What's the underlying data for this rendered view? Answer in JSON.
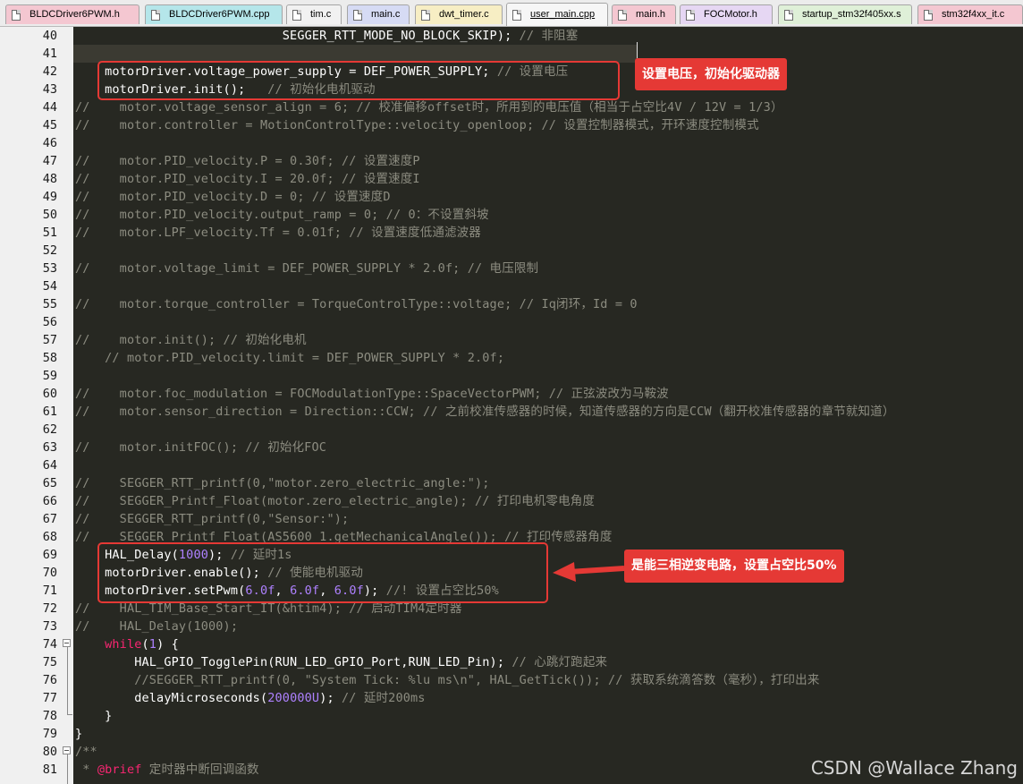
{
  "tabs": [
    {
      "label": "BLDCDriver6PWM.h",
      "color": "#f4c7d1",
      "active": false
    },
    {
      "label": "BLDCDriver6PWM.cpp",
      "color": "#b5e6ea",
      "active": false
    },
    {
      "label": "tim.c",
      "color": "#f1f1f1",
      "active": false
    },
    {
      "label": "main.c",
      "color": "#d6dbf4",
      "active": false
    },
    {
      "label": "dwt_timer.c",
      "color": "#f7eec4",
      "active": false
    },
    {
      "label": "user_main.cpp",
      "color": "#e8f1d2",
      "active": true
    },
    {
      "label": "main.h",
      "color": "#f4c7d1",
      "active": false
    },
    {
      "label": "FOCMotor.h",
      "color": "#e6d7f3",
      "active": false
    },
    {
      "label": "startup_stm32f405xx.s",
      "color": "#dff0d8",
      "active": false
    },
    {
      "label": "stm32f4xx_it.c",
      "color": "#f4c7d1",
      "active": false
    }
  ],
  "lines": [
    {
      "n": "40",
      "t": [
        [
          "code",
          "                            SEGGER_RTT_MODE_NO_BLOCK_SKIP); "
        ],
        [
          "cm",
          "// 非阻塞"
        ]
      ]
    },
    {
      "n": "41",
      "t": []
    },
    {
      "n": "42",
      "t": [
        [
          "code",
          "    motorDriver.voltage_power_supply = DEF_POWER_SUPPLY; "
        ],
        [
          "cm",
          "// 设置电压"
        ]
      ]
    },
    {
      "n": "43",
      "t": [
        [
          "code",
          "    motorDriver.init();   "
        ],
        [
          "cm",
          "// 初始化电机驱动"
        ]
      ]
    },
    {
      "n": "44",
      "t": [
        [
          "cm",
          "//    motor.voltage_sensor_align = 6; // 校准偏移offset时，所用到的电压值（相当于占空比4V / 12V = 1/3）"
        ]
      ]
    },
    {
      "n": "45",
      "t": [
        [
          "cm",
          "//    motor.controller = MotionControlType::velocity_openloop; // 设置控制器模式，开环速度控制模式"
        ]
      ]
    },
    {
      "n": "46",
      "t": []
    },
    {
      "n": "47",
      "t": [
        [
          "cm",
          "//    motor.PID_velocity.P = 0.30f; // 设置速度P"
        ]
      ]
    },
    {
      "n": "48",
      "t": [
        [
          "cm",
          "//    motor.PID_velocity.I = 20.0f; // 设置速度I"
        ]
      ]
    },
    {
      "n": "49",
      "t": [
        [
          "cm",
          "//    motor.PID_velocity.D = 0; // 设置速度D"
        ]
      ]
    },
    {
      "n": "50",
      "t": [
        [
          "cm",
          "//    motor.PID_velocity.output_ramp = 0; // 0：不设置斜坡"
        ]
      ]
    },
    {
      "n": "51",
      "t": [
        [
          "cm",
          "//    motor.LPF_velocity.Tf = 0.01f; // 设置速度低通滤波器"
        ]
      ]
    },
    {
      "n": "52",
      "t": []
    },
    {
      "n": "53",
      "t": [
        [
          "cm",
          "//    motor.voltage_limit = DEF_POWER_SUPPLY * 2.0f; // 电压限制"
        ]
      ]
    },
    {
      "n": "54",
      "t": []
    },
    {
      "n": "55",
      "t": [
        [
          "cm",
          "//    motor.torque_controller = TorqueControlType::voltage; // Iq闭环，Id = 0"
        ]
      ]
    },
    {
      "n": "56",
      "t": []
    },
    {
      "n": "57",
      "t": [
        [
          "cm",
          "//    motor.init(); // 初始化电机"
        ]
      ]
    },
    {
      "n": "58",
      "t": [
        [
          "cm",
          "    // motor.PID_velocity.limit = DEF_POWER_SUPPLY * 2.0f;"
        ]
      ]
    },
    {
      "n": "59",
      "t": []
    },
    {
      "n": "60",
      "t": [
        [
          "cm",
          "//    motor.foc_modulation = FOCModulationType::SpaceVectorPWM; // 正弦波改为马鞍波"
        ]
      ]
    },
    {
      "n": "61",
      "t": [
        [
          "cm",
          "//    motor.sensor_direction = Direction::CCW; // 之前校准传感器的时候，知道传感器的方向是CCW（翻开校准传感器的章节就知道）"
        ]
      ]
    },
    {
      "n": "62",
      "t": []
    },
    {
      "n": "63",
      "t": [
        [
          "cm",
          "//    motor.initFOC(); // 初始化FOC"
        ]
      ]
    },
    {
      "n": "64",
      "t": []
    },
    {
      "n": "65",
      "t": [
        [
          "cm",
          "//    SEGGER_RTT_printf(0,\"motor.zero_electric_angle:\");"
        ]
      ]
    },
    {
      "n": "66",
      "t": [
        [
          "cm",
          "//    SEGGER_Printf_Float(motor.zero_electric_angle); // 打印电机零电角度"
        ]
      ]
    },
    {
      "n": "67",
      "t": [
        [
          "cm",
          "//    SEGGER_RTT_printf(0,\"Sensor:\");"
        ]
      ]
    },
    {
      "n": "68",
      "t": [
        [
          "cm",
          "//    SEGGER_Printf_Float(AS5600_1.getMechanicalAngle()); // 打印传感器角度"
        ]
      ]
    },
    {
      "n": "69",
      "t": [
        [
          "code",
          "    HAL_Delay("
        ],
        [
          "num",
          "1000"
        ],
        [
          "code",
          "); "
        ],
        [
          "cm",
          "// 延时1s"
        ]
      ]
    },
    {
      "n": "70",
      "t": [
        [
          "code",
          "    motorDriver.enable(); "
        ],
        [
          "cm",
          "// 使能电机驱动"
        ]
      ]
    },
    {
      "n": "71",
      "t": [
        [
          "code",
          "    motorDriver.setPwm("
        ],
        [
          "num",
          "6.0f"
        ],
        [
          "code",
          ", "
        ],
        [
          "num",
          "6.0f"
        ],
        [
          "code",
          ", "
        ],
        [
          "num",
          "6.0f"
        ],
        [
          "code",
          "); "
        ],
        [
          "cm",
          "//! 设置占空比50%"
        ]
      ]
    },
    {
      "n": "72",
      "t": [
        [
          "cm",
          "//    HAL_TIM_Base_Start_IT(&htim4); // 启动TIM4定时器"
        ]
      ]
    },
    {
      "n": "73",
      "t": [
        [
          "cm",
          "//    HAL_Delay(1000);"
        ]
      ]
    },
    {
      "n": "74",
      "t": [
        [
          "code",
          "    "
        ],
        [
          "kw",
          "while"
        ],
        [
          "code",
          "("
        ],
        [
          "num",
          "1"
        ],
        [
          "code",
          ") {"
        ]
      ]
    },
    {
      "n": "75",
      "t": [
        [
          "code",
          "        HAL_GPIO_TogglePin(RUN_LED_GPIO_Port,RUN_LED_Pin); "
        ],
        [
          "cm",
          "// 心跳灯跑起来"
        ]
      ]
    },
    {
      "n": "76",
      "t": [
        [
          "cm",
          "        //SEGGER_RTT_printf(0, \"System Tick: %lu ms\\n\", HAL_GetTick()); // 获取系统滴答数（毫秒），打印出来"
        ]
      ]
    },
    {
      "n": "77",
      "t": [
        [
          "code",
          "        delayMicroseconds("
        ],
        [
          "num",
          "200000U"
        ],
        [
          "code",
          "); "
        ],
        [
          "cm",
          "// 延时200ms"
        ]
      ]
    },
    {
      "n": "78",
      "t": [
        [
          "code",
          "    }"
        ]
      ]
    },
    {
      "n": "79",
      "t": [
        [
          "code",
          "}"
        ]
      ]
    },
    {
      "n": "80",
      "t": [
        [
          "cm",
          "/**"
        ]
      ]
    },
    {
      "n": "81",
      "t": [
        [
          "cm",
          " * "
        ],
        [
          "tag",
          "@brief"
        ],
        [
          "cm",
          " 定时器中断回调函数"
        ]
      ]
    }
  ],
  "annotations": {
    "callout_top": "设置电压，初始化驱动器",
    "callout_bottom": "是能三相逆变电路，设置占空比50%",
    "accent_color": "#e53935"
  },
  "watermark": "CSDN @Wallace Zhang"
}
